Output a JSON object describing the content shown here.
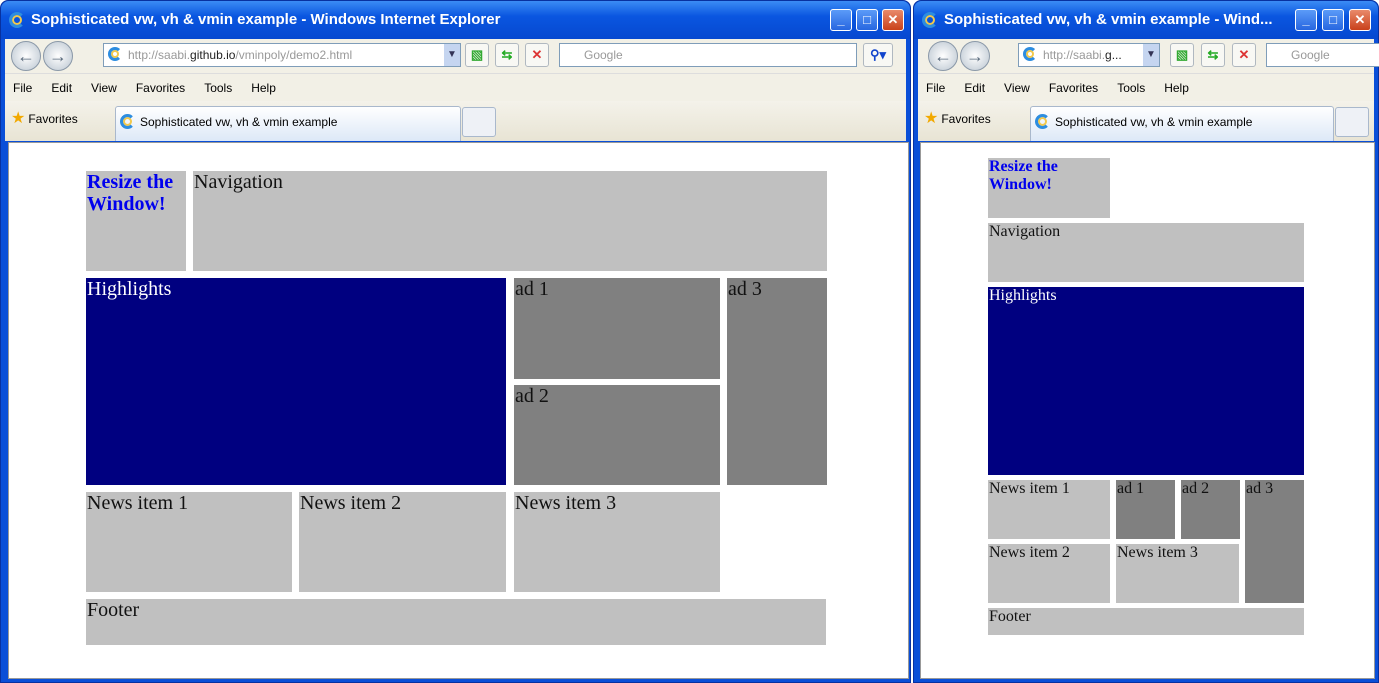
{
  "left_window": {
    "title": "Sophisticated vw, vh & vmin example - Windows Internet Explorer",
    "address_prefix": "http://saabi.",
    "address_domain": "github.io",
    "address_path": "/vminpoly/demo2.html",
    "search_placeholder": "Google",
    "menu": [
      "File",
      "Edit",
      "View",
      "Favorites",
      "Tools",
      "Help"
    ],
    "favorites": "Favorites",
    "tab": "Sophisticated vw, vh & vmin example"
  },
  "right_window": {
    "title": "Sophisticated vw, vh & vmin example - Wind...",
    "address_prefix": "http://saabi.",
    "address_domain": "g...",
    "search_placeholder": "Google",
    "menu": [
      "File",
      "Edit",
      "View",
      "Favorites",
      "Tools",
      "Help"
    ],
    "favorites": "Favorites",
    "tab": "Sophisticated vw, vh & vmin example"
  },
  "page": {
    "resize": "Resize the Window!",
    "navigation": "Navigation",
    "highlights": "Highlights",
    "ad1": "ad 1",
    "ad2": "ad 2",
    "ad3": "ad 3",
    "news1": "News item 1",
    "news2": "News item 2",
    "news3": "News item 3",
    "footer": "Footer"
  },
  "colors": {
    "light_gray": "#c0c0c0",
    "dark_gray": "#808080",
    "navy": "#000080",
    "link": "#0000ee"
  }
}
